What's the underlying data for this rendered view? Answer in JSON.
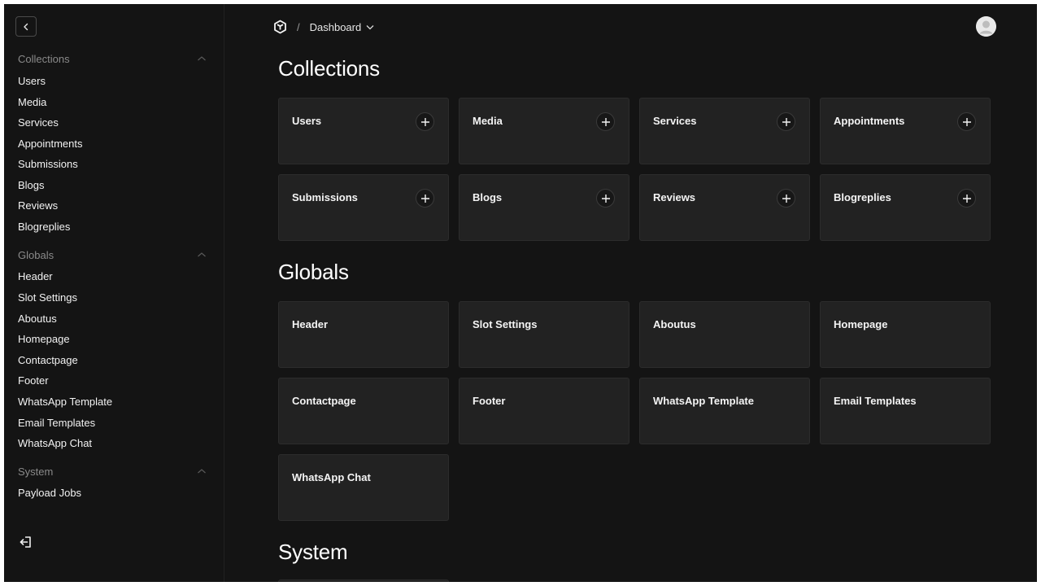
{
  "sidebar": {
    "groups": [
      {
        "label": "Collections",
        "items": [
          "Users",
          "Media",
          "Services",
          "Appointments",
          "Submissions",
          "Blogs",
          "Reviews",
          "Blogreplies"
        ]
      },
      {
        "label": "Globals",
        "items": [
          "Header",
          "Slot Settings",
          "Aboutus",
          "Homepage",
          "Contactpage",
          "Footer",
          "WhatsApp Template",
          "Email Templates",
          "WhatsApp Chat"
        ]
      },
      {
        "label": "System",
        "items": [
          "Payload Jobs"
        ]
      }
    ]
  },
  "breadcrumb": {
    "separator": "/",
    "current": "Dashboard"
  },
  "sections": {
    "collections": {
      "title": "Collections",
      "cards": [
        "Users",
        "Media",
        "Services",
        "Appointments",
        "Submissions",
        "Blogs",
        "Reviews",
        "Blogreplies"
      ]
    },
    "globals": {
      "title": "Globals",
      "cards": [
        "Header",
        "Slot Settings",
        "Aboutus",
        "Homepage",
        "Contactpage",
        "Footer",
        "WhatsApp Template",
        "Email Templates",
        "WhatsApp Chat"
      ]
    },
    "system": {
      "title": "System"
    }
  },
  "colors": {
    "background": "#141414",
    "card": "#222222",
    "text": "#ffffff",
    "muted": "#8a8a8a"
  },
  "icons": [
    "chevron-left-icon",
    "chevron-up-icon",
    "logo-icon",
    "chevron-down-icon",
    "avatar-icon",
    "plus-icon",
    "logout-icon"
  ]
}
